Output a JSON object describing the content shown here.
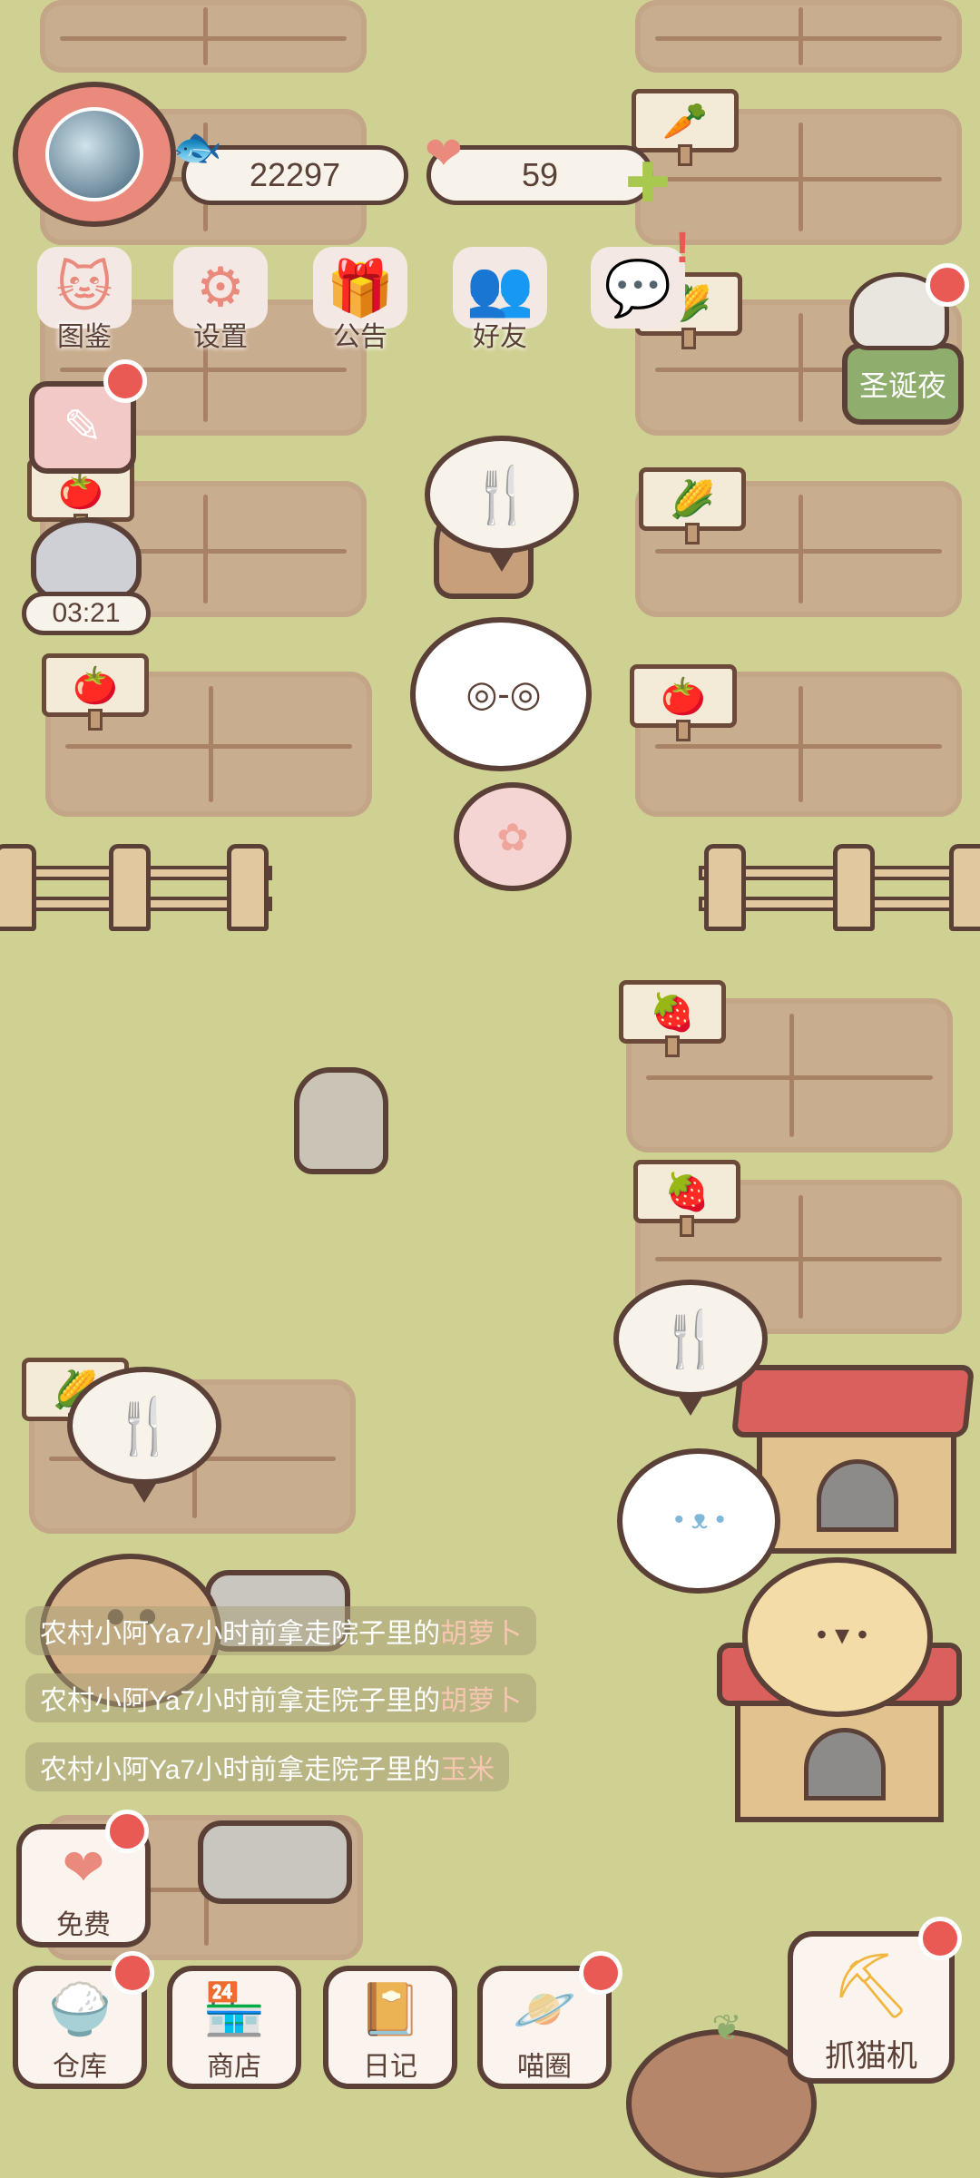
{
  "hud": {
    "fish_count": "22297",
    "heart_count": "59",
    "menu": [
      {
        "label": "图鉴"
      },
      {
        "label": "设置"
      },
      {
        "label": "公告"
      },
      {
        "label": "好友"
      }
    ],
    "event_label": "圣诞夜",
    "timer": "03:21"
  },
  "icons": {
    "fish": "fish-icon",
    "heart": "heart-icon",
    "plus": "plus-icon",
    "catalog": "cat-catalog-icon",
    "settings": "gear-icon",
    "notice": "gift-icon",
    "friends": "friends-icon",
    "diary_pencil": "pencil-icon"
  },
  "crops": [
    "carrot",
    "corn",
    "tomato",
    "strawberry",
    "strawberry",
    "tomato",
    "tomato",
    "corn"
  ],
  "feed": [
    {
      "prefix": "农村小阿Ya7小时前拿走院子里的",
      "item": "胡萝卜"
    },
    {
      "prefix": "农村小阿Ya7小时前拿走院子里的",
      "item": "胡萝卜"
    },
    {
      "prefix": "农村小阿Ya7小时前拿走院子里的",
      "item": "玉米"
    }
  ],
  "buttons": {
    "free": "免费",
    "warehouse": "仓库",
    "shop": "商店",
    "diary": "日记",
    "meow_circle": "喵圈",
    "claw_machine": "抓猫机"
  },
  "colors": {
    "grass": "#cfd193",
    "soil": "#c9ad8f",
    "outline": "#5a4037",
    "accent": "#e98a7c",
    "event": "#8fae6e",
    "badge": "#ea5a55"
  }
}
